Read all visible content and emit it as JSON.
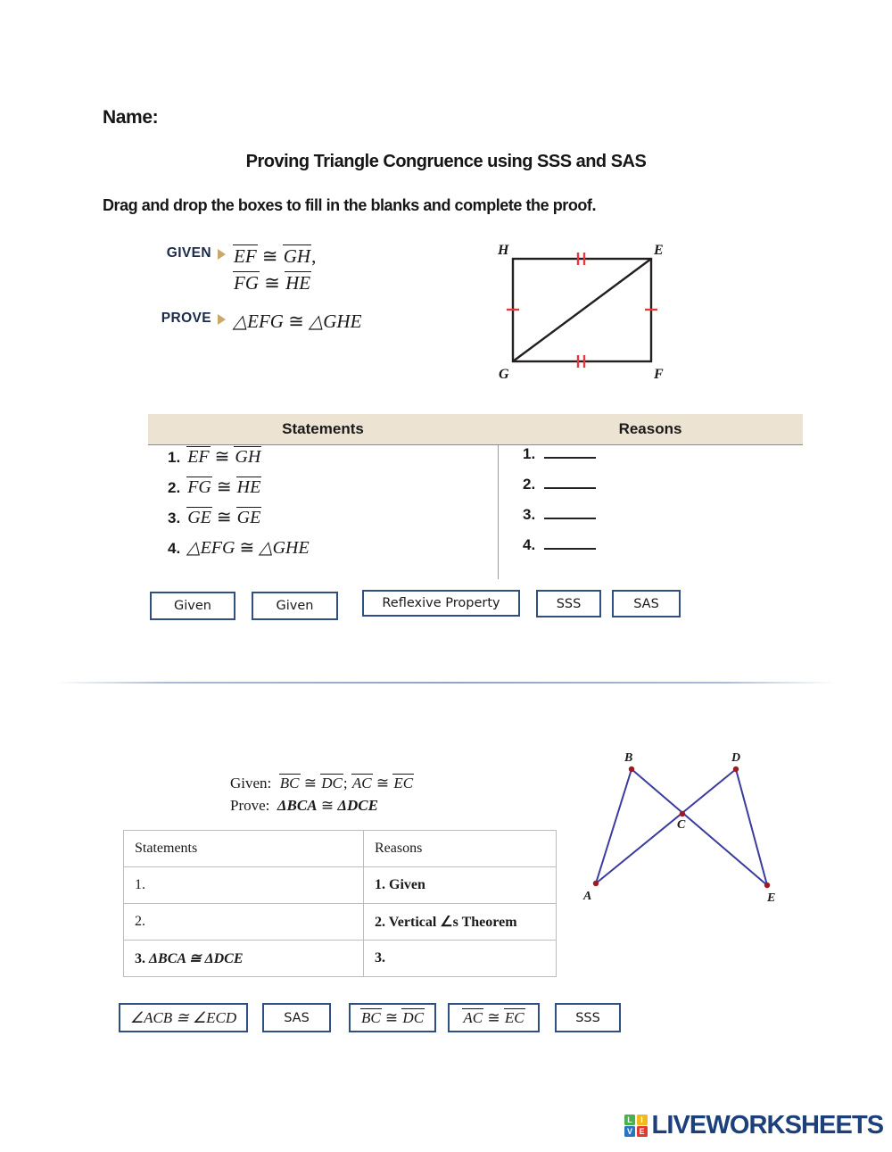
{
  "header": {
    "name_label": "Name:",
    "title": "Proving Triangle Congruence using SSS and SAS",
    "instructions": "Drag and drop the boxes to fill in the blanks and complete the proof."
  },
  "proof1": {
    "given_label": "GIVEN",
    "prove_label": "PROVE",
    "given_line1_a": "EF",
    "given_line1_sym": "≅",
    "given_line1_b": "GH",
    "given_line1_tail": ",",
    "given_line2_a": "FG",
    "given_line2_sym": "≅",
    "given_line2_b": "HE",
    "prove_a": "△EFG",
    "prove_sym": "≅",
    "prove_b": "△GHE",
    "figure": {
      "vertex_top_left": "H",
      "vertex_top_right": "E",
      "vertex_bottom_left": "G",
      "vertex_bottom_right": "F",
      "tick_color": "#e8373c",
      "line_color": "#231f20",
      "top_ticks": 2,
      "bottom_ticks": 2,
      "left_ticks": 1,
      "right_ticks": 1,
      "diagonal": "G to E"
    },
    "table": {
      "header_statements": "Statements",
      "header_reasons": "Reasons",
      "header_bg": "#ece3d2",
      "statements": [
        {
          "num": "1.",
          "a": "EF",
          "sym": "≅",
          "b": "GH",
          "tri": false
        },
        {
          "num": "2.",
          "a": "FG",
          "sym": "≅",
          "b": "HE",
          "tri": false
        },
        {
          "num": "3.",
          "a": "GE",
          "sym": "≅",
          "b": "GE",
          "tri": false
        },
        {
          "num": "4.",
          "a": "△EFG",
          "sym": "≅",
          "b": "△GHE",
          "tri": true
        }
      ],
      "reasons": [
        {
          "num": "1.",
          "value": ""
        },
        {
          "num": "2.",
          "value": ""
        },
        {
          "num": "3.",
          "value": ""
        },
        {
          "num": "4.",
          "value": ""
        }
      ]
    },
    "answer_boxes": [
      {
        "label": "Given"
      },
      {
        "label": "Given"
      },
      {
        "label": "Reflexive Property"
      },
      {
        "label": "SSS"
      },
      {
        "label": "SAS"
      }
    ]
  },
  "proof2": {
    "given_label": "Given:",
    "prove_label": "Prove:",
    "given_a": "BC",
    "given_sym1": "≅",
    "given_b": "DC",
    "given_sep": ";",
    "given_c": "AC",
    "given_sym2": "≅",
    "given_d": "EC",
    "prove_a": "ΔBCA",
    "prove_sym": "≅",
    "prove_b": "ΔDCE",
    "figure": {
      "points": [
        "A",
        "B",
        "C",
        "D",
        "E"
      ],
      "line_color": "#3b3b9e",
      "dot_color": "#9d1b20",
      "segments": [
        "A-B",
        "B-E",
        "A-D",
        "D-E"
      ]
    },
    "table": {
      "header_statements": "Statements",
      "header_reasons": "Reasons",
      "rows": [
        {
          "statement_num": "1.",
          "statement_math": "",
          "reason": "1.  Given"
        },
        {
          "statement_num": "2.",
          "statement_math": "",
          "reason": "2. Vertical ∠s Theorem"
        },
        {
          "statement_num": "3.",
          "statement_math": "ΔBCA ≅ ΔDCE",
          "reason": "3."
        }
      ]
    },
    "answer_boxes": [
      {
        "label": "∠ACB ≅ ∠ECD",
        "kind": "math_plain"
      },
      {
        "label": "SAS",
        "kind": "text"
      },
      {
        "label": "BC ≅ DC",
        "kind": "math_bar",
        "a": "BC",
        "sym": "≅",
        "b": "DC"
      },
      {
        "label": "AC ≅ EC",
        "kind": "math_bar",
        "a": "AC",
        "sym": "≅",
        "b": "EC"
      },
      {
        "label": "SSS",
        "kind": "text"
      }
    ]
  },
  "footer": {
    "logo_cells": [
      {
        "letter": "L",
        "color": "#4caf50"
      },
      {
        "letter": "I",
        "color": "#f2b91c"
      },
      {
        "letter": "V",
        "color": "#2a74c4"
      },
      {
        "letter": "E",
        "color": "#e0392e"
      }
    ],
    "brand": "LIVEWORKSHEETS",
    "brand_color": "#1d3f7a"
  }
}
